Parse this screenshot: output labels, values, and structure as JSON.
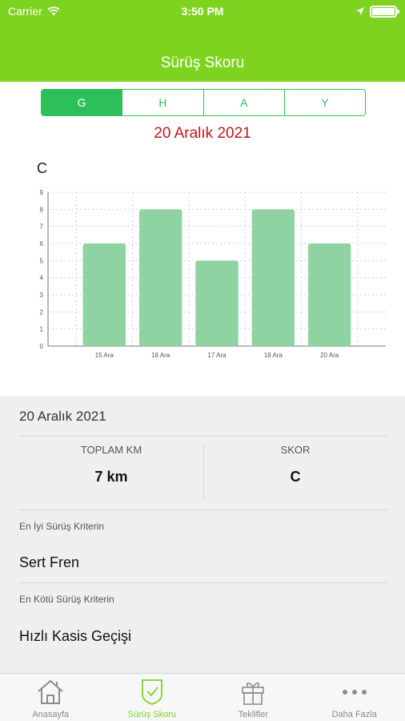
{
  "status_bar": {
    "carrier": "Carrier",
    "time": "3:50 PM"
  },
  "header": {
    "title": "Sürüş Skoru"
  },
  "segments": [
    {
      "label": "G",
      "active": true
    },
    {
      "label": "H",
      "active": false
    },
    {
      "label": "A",
      "active": false
    },
    {
      "label": "Y",
      "active": false
    }
  ],
  "selected_date": "20 Aralık 2021",
  "score_letter": "C",
  "chart_data": {
    "type": "bar",
    "categories": [
      "15 Ara",
      "16 Ara",
      "17 Ara",
      "18 Ara",
      "20 Ara"
    ],
    "values": [
      6,
      8,
      5,
      8,
      6
    ],
    "ylim": [
      0,
      9
    ],
    "yticks": [
      0,
      1,
      2,
      3,
      4,
      5,
      6,
      7,
      8,
      9
    ],
    "grid": true,
    "bar_color": "#8fd3a3"
  },
  "details": {
    "date": "20 Aralık 2021",
    "total_km_label": "TOPLAM KM",
    "total_km_value": "7 km",
    "score_label": "SKOR",
    "score_value": "C",
    "best_label": "En İyi Sürüş Kriterin",
    "best_value": "Sert Fren",
    "worst_label": "En Kötü Sürüş Kriterin",
    "worst_value": "Hızlı Kasis Geçişi"
  },
  "tabs": [
    {
      "label": "Anasayfa",
      "icon": "home-icon",
      "active": false
    },
    {
      "label": "Sürüş Skoru",
      "icon": "shield-check-icon",
      "active": true
    },
    {
      "label": "Teklifler",
      "icon": "gift-icon",
      "active": false
    },
    {
      "label": "Daha Fazla",
      "icon": "more-icon",
      "active": false
    }
  ],
  "colors": {
    "brand_green": "#7ed321",
    "segment_green": "#2dbf5a",
    "date_red": "#c4161c"
  }
}
